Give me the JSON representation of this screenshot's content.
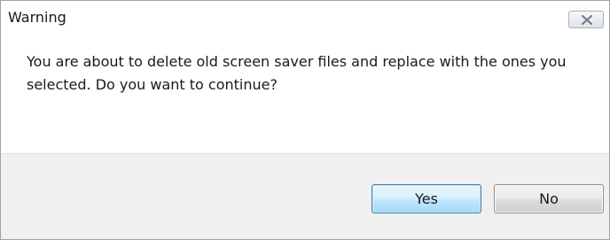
{
  "window": {
    "title": "Warning",
    "close_icon": "close-icon"
  },
  "message": {
    "text": "You are about to delete old screen saver files and replace with the ones you selected. Do you want to continue?"
  },
  "buttons": {
    "yes_label": "Yes",
    "no_label": "No"
  },
  "colors": {
    "default_button_border": "#3c7fb1",
    "footer_background": "#f0f0f0"
  }
}
